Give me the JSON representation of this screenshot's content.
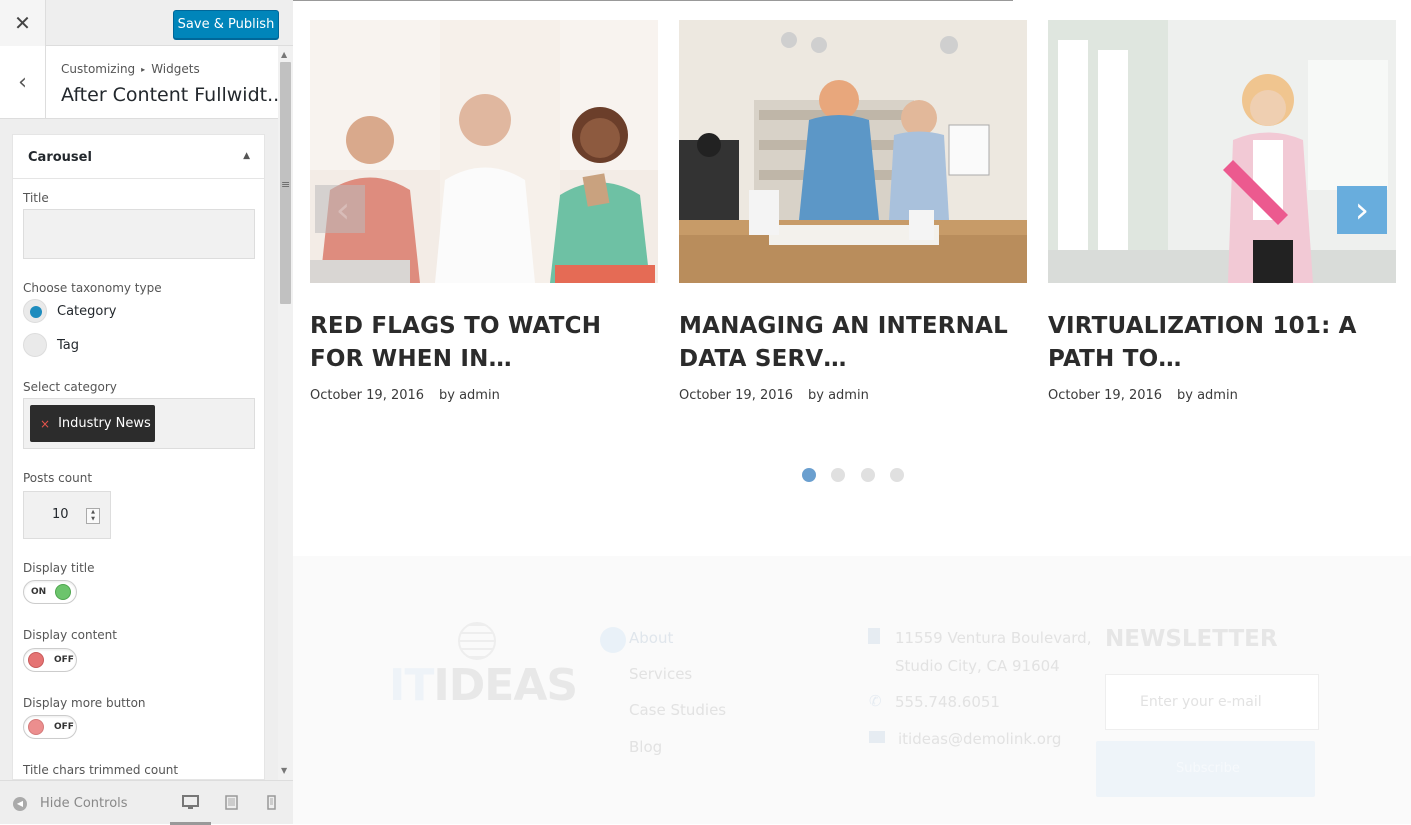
{
  "customizer": {
    "save_label": "Save & Publish",
    "breadcrumb": {
      "root": "Customizing",
      "separator": "▸",
      "parent": "Widgets"
    },
    "section_title": "After Content Fullwidt...",
    "widget": {
      "title": "Carousel",
      "fields": {
        "title_label": "Title",
        "title_value": "",
        "taxonomy_label": "Choose taxonomy type",
        "taxonomy_options": [
          "Category",
          "Tag"
        ],
        "taxonomy_selected": "Category",
        "category_label": "Select category",
        "category_chip": "Industry News",
        "chip_remove": "×",
        "posts_count_label": "Posts count",
        "posts_count": "10",
        "display_title_label": "Display title",
        "display_title_state": "ON",
        "display_content_label": "Display content",
        "display_content_state": "OFF",
        "display_more_label": "Display more button",
        "display_more_state": "OFF",
        "trimmed_label": "Title chars trimmed count"
      }
    },
    "footer": {
      "hide_controls": "Hide Controls",
      "devices": [
        "desktop-icon",
        "tablet-icon",
        "mobile-icon"
      ]
    }
  },
  "preview": {
    "posts": [
      {
        "title": "RED FLAGS TO WATCH FOR WHEN IN…",
        "date": "October 19, 2016",
        "author": "by admin"
      },
      {
        "title": "MANAGING AN INTERNAL DATA SERV…",
        "date": "October 19, 2016",
        "author": "by admin"
      },
      {
        "title": "VIRTUALIZATION 101: A PATH TO…",
        "date": "October 19, 2016",
        "author": "by admin"
      }
    ],
    "pager": {
      "count": 4,
      "active": 1
    },
    "footer": {
      "logo": {
        "it": "IT",
        "ideas": "IDEAS"
      },
      "nav": [
        "About",
        "Services",
        "Case Studies",
        "Blog"
      ],
      "address_line1": "11559 Ventura Boulevard,",
      "address_line2": "Studio City, CA 91604",
      "phone": "555.748.6051",
      "email": "itideas@demolink.org",
      "newsletter_title": "NEWSLETTER",
      "newsletter_placeholder": "Enter your e-mail",
      "subscribe_label": "Subscribe"
    }
  },
  "colors": {
    "accent": "#0085ba",
    "pager_active": "#6a9fcf",
    "switch_on": "#6cc46c",
    "switch_off": "#e57373"
  }
}
